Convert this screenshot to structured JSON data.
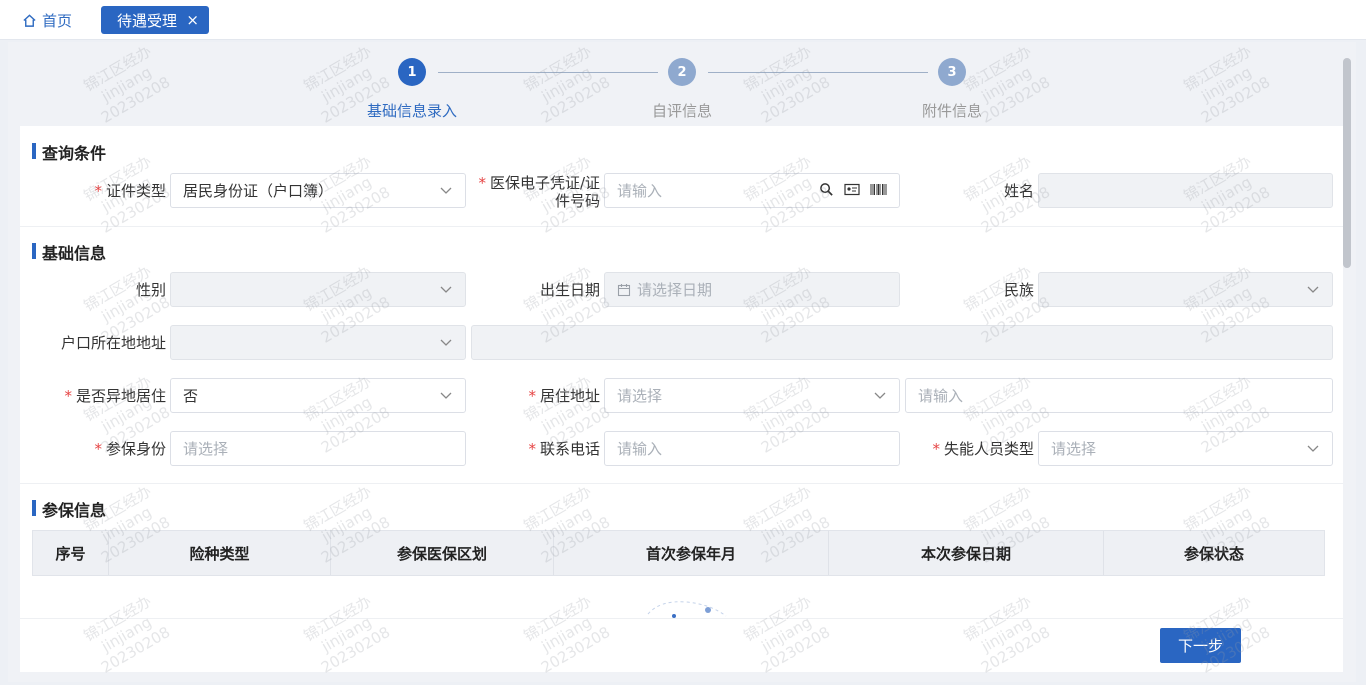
{
  "tabs": {
    "home_label": "首页",
    "active_label": "待遇受理",
    "close_glyph": "×"
  },
  "steps": [
    {
      "number": "1",
      "label": "基础信息录入",
      "state": "active"
    },
    {
      "number": "2",
      "label": "自评信息",
      "state": "pending"
    },
    {
      "number": "3",
      "label": "附件信息",
      "state": "pending"
    }
  ],
  "query_section": {
    "title": "查询条件",
    "cert_type_label": "证件类型",
    "cert_type_value": "居民身份证（户口簿）",
    "id_number_label_line1": "医保电子凭证/证",
    "id_number_label_line2": "件号码",
    "id_number_placeholder": "请输入",
    "name_label": "姓名"
  },
  "basic_section": {
    "title": "基础信息",
    "gender_label": "性别",
    "birth_label": "出生日期",
    "birth_placeholder": "请选择日期",
    "ethnicity_label": "民族",
    "hukou_label": "户口所在地地址",
    "remote_label": "是否异地居住",
    "remote_value": "否",
    "residence_label": "居住地址",
    "residence_select_placeholder": "请选择",
    "residence_input_placeholder": "请输入",
    "insured_identity_label": "参保身份",
    "insured_identity_placeholder": "请选择",
    "phone_label": "联系电话",
    "phone_placeholder": "请输入",
    "disability_label": "失能人员类型",
    "disability_placeholder": "请选择"
  },
  "insurance_section": {
    "title": "参保信息",
    "columns": [
      "序号",
      "险种类型",
      "参保医保区划",
      "首次参保年月",
      "本次参保日期",
      "参保状态"
    ]
  },
  "next_button": "下一步",
  "watermark": {
    "line1": "锦江区经办",
    "line2": "jinjiang",
    "line3": "20230208"
  },
  "colors": {
    "primary": "#2a66c2",
    "required": "#e64545",
    "step_pending": "#8fa9cf"
  }
}
